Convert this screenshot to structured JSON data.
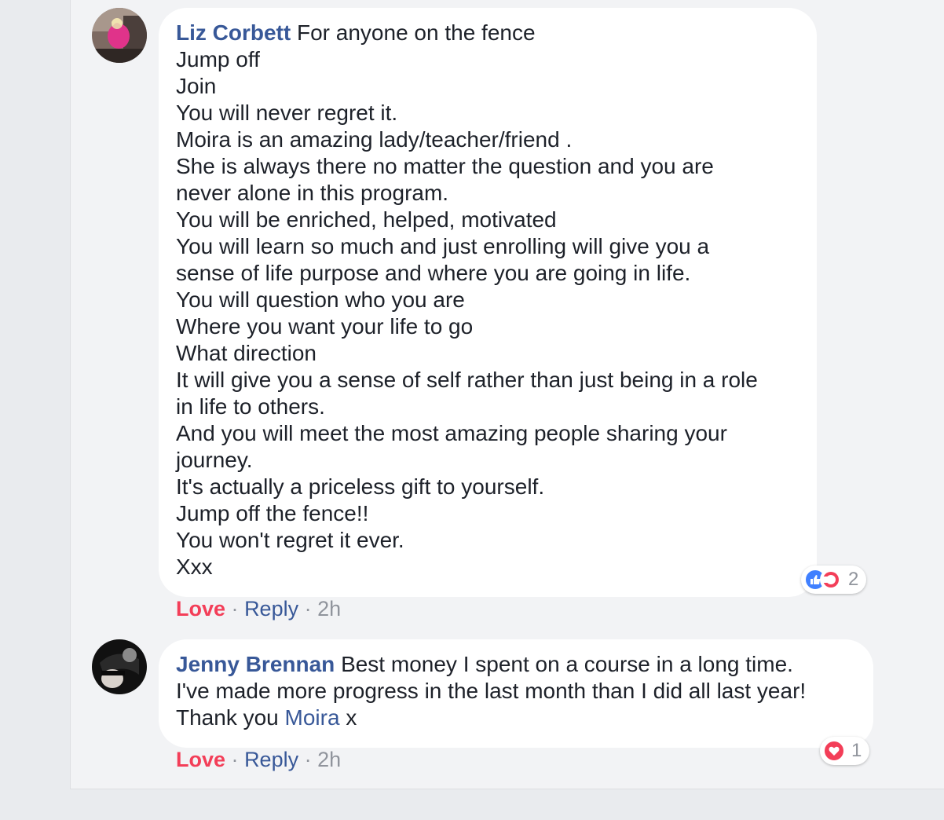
{
  "comments": [
    {
      "author": "Liz Corbett",
      "text_lines": [
        "For anyone on the fence",
        "Jump off",
        "Join",
        "You will never regret it.",
        "Moira is an amazing lady/teacher/friend .",
        "She is always there no matter the question and you are",
        "never alone in this program.",
        "You will be enriched, helped, motivated",
        "You will learn so much and just enrolling will give you a",
        "sense of life purpose and where you are going in life.",
        "You will question who you are",
        "Where you want your life to go",
        "What direction",
        "It will give you a sense of self rather than just being in a role",
        "in life to others.",
        "And you will meet the most amazing people sharing your",
        "journey.",
        "It's actually a priceless gift to yourself.",
        "Jump off the fence!!",
        "You won't regret it ever.",
        "Xxx"
      ],
      "reactions": {
        "icons": [
          "like-icon",
          "haha-icon"
        ],
        "count": "2"
      },
      "actions": {
        "love": "Love",
        "reply": "Reply",
        "time": "2h",
        "separator": "·"
      }
    },
    {
      "author": "Jenny Brennan",
      "text_lines": [
        "Best money I spent on a course in a long time.",
        "I've made more progress in the last month than I did all last year!",
        "Thank you"
      ],
      "mention": "Moira",
      "mention_suffix": "x",
      "reactions": {
        "icons": [
          "love-icon"
        ],
        "count": "1"
      },
      "actions": {
        "love": "Love",
        "reply": "Reply",
        "time": "2h",
        "separator": "·"
      }
    }
  ],
  "colors": {
    "author": "#385898",
    "love": "#f33e58",
    "like": "#4080ff",
    "meta": "#90949c",
    "background": "#e9ebee"
  }
}
